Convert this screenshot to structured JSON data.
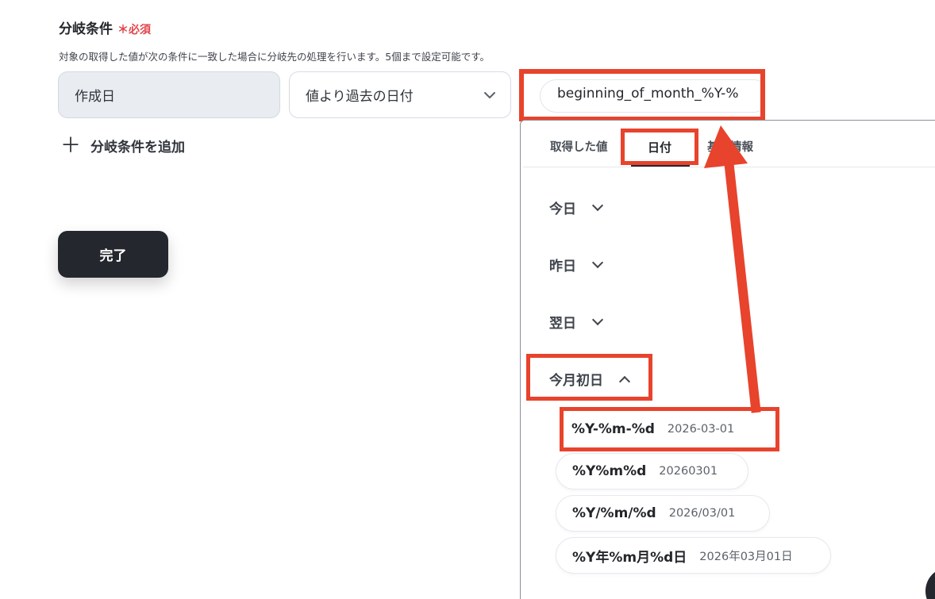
{
  "section": {
    "title": "分岐条件",
    "required_mark": "＊必須",
    "description": "対象の取得した値が次の条件に一致した場合に分岐先の処理を行います。5個まで設定可能です。"
  },
  "condition": {
    "source_value": "作成日",
    "operator_value": "値より過去の日付",
    "compare_value": "beginning_of_month_%Y-%"
  },
  "add_condition_label": "分岐条件を追加",
  "done_label": "完了",
  "picker": {
    "tabs": [
      {
        "label": "取得した値"
      },
      {
        "label": "日付",
        "active": true
      },
      {
        "label": "基本情報"
      }
    ],
    "groups": [
      {
        "label": "今日",
        "expanded": false
      },
      {
        "label": "昨日",
        "expanded": false
      },
      {
        "label": "翌日",
        "expanded": false
      },
      {
        "label": "今月初日",
        "expanded": true
      }
    ],
    "formats": [
      {
        "format": "%Y-%m-%d",
        "example": "2026-03-01"
      },
      {
        "format": "%Y%m%d",
        "example": "20260301"
      },
      {
        "format": "%Y/%m/%d",
        "example": "2026/03/01"
      },
      {
        "format": "%Y年%m月%d日",
        "example": "2026年03月01日"
      }
    ]
  },
  "colors": {
    "highlight": "#e8432c",
    "button_dark": "#24272e",
    "required": "#e0464c"
  }
}
